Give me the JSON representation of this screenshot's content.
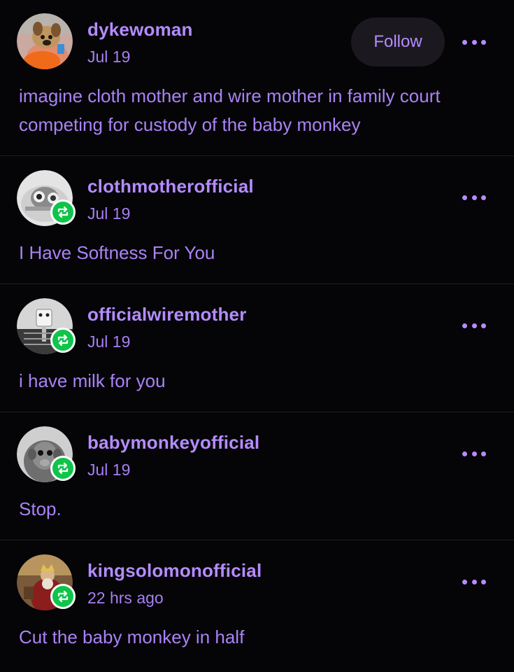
{
  "posts": [
    {
      "username": "dykewoman",
      "date": "Jul 19",
      "follow_label": "Follow",
      "text": "imagine cloth mother and wire mother in family court competing for custody of the baby monkey",
      "avatar_icon": "plush-dog-avatar",
      "reblogged": false
    },
    {
      "username": "clothmotherofficial",
      "date": "Jul 19",
      "text": "I Have Softness For You",
      "avatar_icon": "cloth-mother-avatar",
      "reblogged": true
    },
    {
      "username": "officialwiremother",
      "date": "Jul 19",
      "text": "i have milk for you",
      "avatar_icon": "wire-mother-avatar",
      "reblogged": true
    },
    {
      "username": "babymonkeyofficial",
      "date": "Jul 19",
      "text": "Stop.",
      "avatar_icon": "baby-monkey-avatar",
      "reblogged": true
    },
    {
      "username": "kingsolomonofficial",
      "date": "22 hrs ago",
      "text": "Cut the baby monkey in half",
      "avatar_icon": "king-solomon-avatar",
      "reblogged": true
    }
  ],
  "colors": {
    "background": "#050407",
    "accent": "#b48cff",
    "reblog_badge": "#0fc44a",
    "divider": "#1f1a29",
    "follow_button_bg": "#1b191f"
  }
}
